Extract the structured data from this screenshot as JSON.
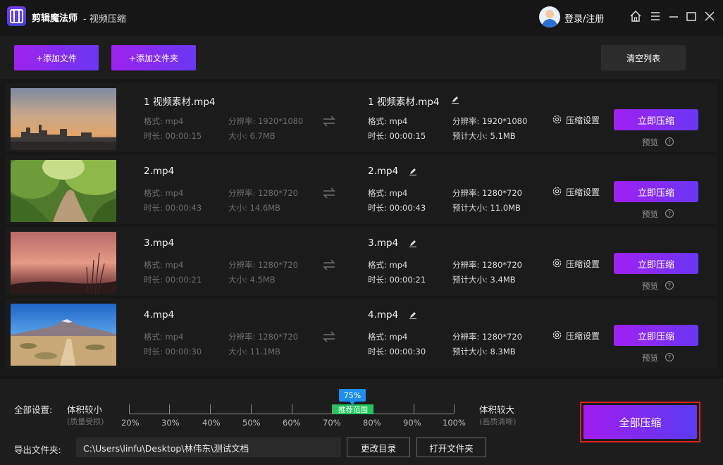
{
  "app": {
    "name": "剪辑魔法师",
    "subtitle": "- 视频压缩",
    "login": "登录/注册"
  },
  "toolbar": {
    "add_file": "+添加文件",
    "add_folder": "+添加文件夹",
    "clear_list": "清空列表"
  },
  "files": [
    {
      "name": "1 视频素材.mp4",
      "src_format": "格式: mp4",
      "src_resolution": "分辨率: 1920*1080",
      "src_duration": "时长: 00:00:15",
      "src_size": "大小: 6.7MB",
      "out_name": "1 视频素材.mp4",
      "out_format": "格式: mp4",
      "out_resolution": "分辨率: 1920*1080",
      "out_duration": "时长: 00:00:15",
      "out_size": "预计大小: 5.1MB"
    },
    {
      "name": "2.mp4",
      "src_format": "格式: mp4",
      "src_resolution": "分辨率: 1280*720",
      "src_duration": "时长: 00:00:43",
      "src_size": "大小: 14.6MB",
      "out_name": "2.mp4",
      "out_format": "格式: mp4",
      "out_resolution": "分辨率: 1280*720",
      "out_duration": "时长: 00:00:43",
      "out_size": "预计大小: 11.0MB"
    },
    {
      "name": "3.mp4",
      "src_format": "格式: mp4",
      "src_resolution": "分辨率: 1280*720",
      "src_duration": "时长: 00:00:21",
      "src_size": "大小: 4.5MB",
      "out_name": "3.mp4",
      "out_format": "格式: mp4",
      "out_resolution": "分辨率: 1280*720",
      "out_duration": "时长: 00:00:21",
      "out_size": "预计大小: 3.4MB"
    },
    {
      "name": "4.mp4",
      "src_format": "格式: mp4",
      "src_resolution": "分辨率: 1280*720",
      "src_duration": "时长: 00:00:30",
      "src_size": "大小: 11.1MB",
      "out_name": "4.mp4",
      "out_format": "格式: mp4",
      "out_resolution": "分辨率: 1280*720",
      "out_duration": "时长: 00:00:30",
      "out_size": "预计大小: 8.3MB"
    }
  ],
  "row_actions": {
    "settings": "压缩设置",
    "compress_now": "立即压缩",
    "preview": "预览"
  },
  "settings": {
    "label": "全部设置:",
    "small_label": "体积较小",
    "small_hint": "(质量受损)",
    "large_label": "体积较大",
    "large_hint": "(画质清晰)",
    "value": "75%",
    "recommended": "推荐范围",
    "ticks": [
      "20%",
      "30%",
      "40%",
      "50%",
      "60%",
      "70%",
      "80%",
      "90%",
      "100%"
    ]
  },
  "export": {
    "label": "导出文件夹:",
    "path": "C:\\Users\\linfu\\Desktop\\林伟东\\测试文档",
    "change_dir": "更改目录",
    "open_folder": "打开文件夹",
    "compress_all": "全部压缩"
  }
}
